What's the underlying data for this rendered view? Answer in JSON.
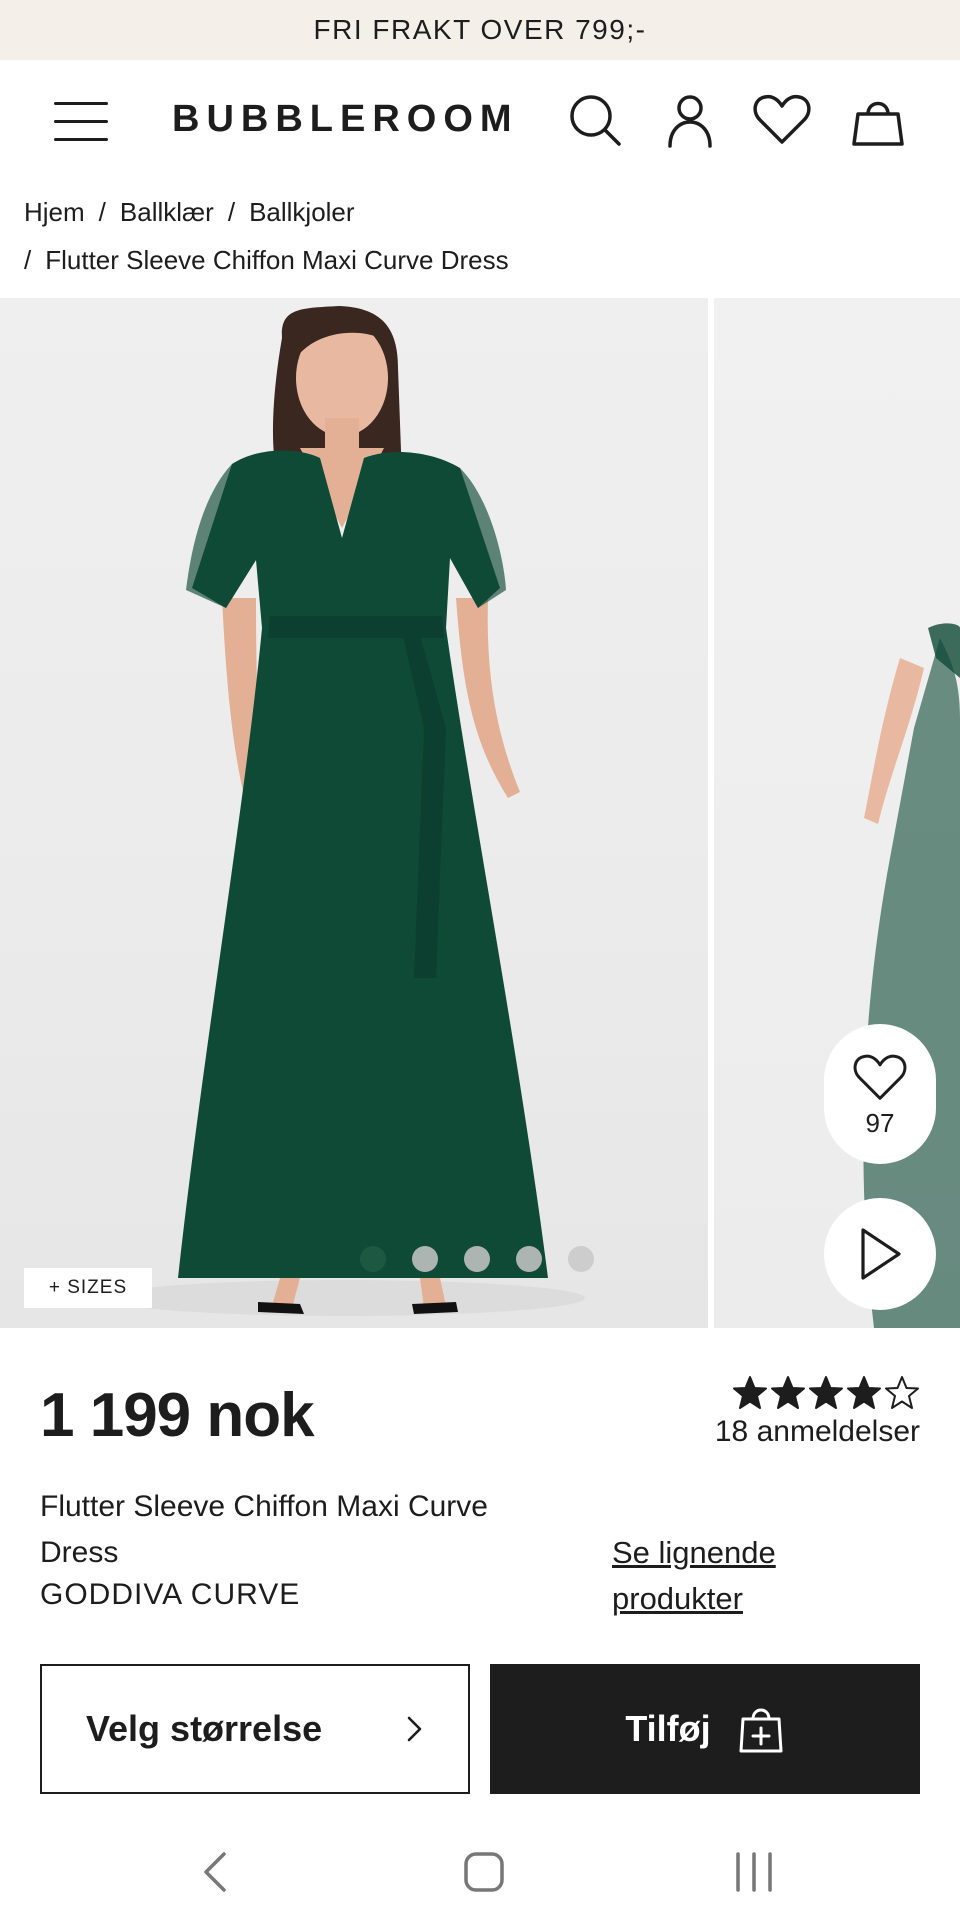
{
  "promo": {
    "text": "FRI FRAKT OVER 799;-"
  },
  "header": {
    "logo": "BUBBLEROOM",
    "icons": [
      "menu-icon",
      "search-icon",
      "user-icon",
      "heart-icon",
      "bag-icon"
    ]
  },
  "breadcrumb": {
    "items": [
      "Hjem",
      "Ballklær",
      "Ballkjoler",
      "Flutter Sleeve Chiffon Maxi Curve Dress"
    ],
    "separator": "/"
  },
  "gallery": {
    "sizes_tag": "+ SIZES",
    "wishlist_count": "97",
    "dot_count": 5,
    "active_dot": 1,
    "dress_color": "#0f4a37",
    "background_color": "#ececec"
  },
  "product": {
    "price": "1 199 nok",
    "rating": 4.0,
    "rating_max": 5,
    "reviews": "18 anmeldelser",
    "name_line1": "Flutter Sleeve Chiffon Maxi Curve",
    "name_line2": "Dress",
    "brand": "GODDIVA CURVE",
    "similar_line1": "Se lignende",
    "similar_line2": "produkter"
  },
  "actions": {
    "size_label": "Velg størrelse",
    "add_label": "Tilføj"
  },
  "system_nav": {
    "icons": [
      "back-icon",
      "home-icon",
      "recents-icon"
    ]
  },
  "colors": {
    "promo_bg": "#f5efe9",
    "text": "#1d1d1d",
    "button_dark": "#1d1d1d"
  }
}
